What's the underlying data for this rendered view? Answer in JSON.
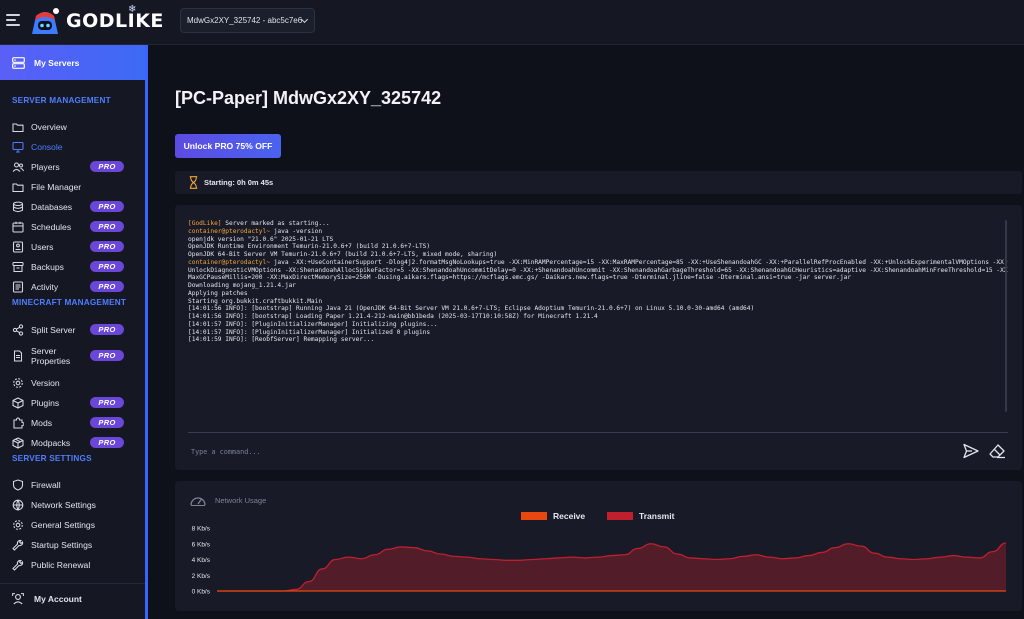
{
  "topbar": {
    "logo_text": "GODLIKE",
    "server_selector": "MdwGx2XY_325742 - abc5c7e6"
  },
  "sidebar": {
    "my_servers": "My Servers",
    "sections": [
      {
        "title": "SERVER MANAGEMENT",
        "items": [
          {
            "label": "Overview",
            "icon": "folder-icon",
            "pro": false
          },
          {
            "label": "Console",
            "icon": "monitor-icon",
            "pro": false,
            "active": true
          },
          {
            "label": "Players",
            "icon": "users-icon",
            "pro": true
          },
          {
            "label": "File Manager",
            "icon": "folder-icon",
            "pro": false
          },
          {
            "label": "Databases",
            "icon": "database-icon",
            "pro": true
          },
          {
            "label": "Schedules",
            "icon": "calendar-icon",
            "pro": true
          },
          {
            "label": "Users",
            "icon": "id-card-icon",
            "pro": true
          },
          {
            "label": "Backups",
            "icon": "archive-icon",
            "pro": true
          },
          {
            "label": "Activity",
            "icon": "list-icon",
            "pro": true
          }
        ]
      },
      {
        "title": "MINECRAFT MANAGEMENT",
        "items": [
          {
            "label": "Split Server",
            "icon": "share-icon",
            "pro": true
          },
          {
            "label": "Server Properties",
            "icon": "file-icon",
            "pro": true
          },
          {
            "label": "Version",
            "icon": "gear-icon",
            "pro": false
          },
          {
            "label": "Plugins",
            "icon": "cube-icon",
            "pro": true
          },
          {
            "label": "Mods",
            "icon": "puzzle-icon",
            "pro": true
          },
          {
            "label": "Modpacks",
            "icon": "package-icon",
            "pro": true
          }
        ]
      },
      {
        "title": "SERVER SETTINGS",
        "items": [
          {
            "label": "Firewall",
            "icon": "shield-icon",
            "pro": false
          },
          {
            "label": "Network Settings",
            "icon": "network-icon",
            "pro": false
          },
          {
            "label": "General Settings",
            "icon": "gear-icon",
            "pro": false
          },
          {
            "label": "Startup Settings",
            "icon": "wrench-icon",
            "pro": false
          },
          {
            "label": "Public Renewal",
            "icon": "wrench-icon",
            "pro": false
          }
        ]
      }
    ],
    "pro_badge": "PRO",
    "account": "My Account"
  },
  "main": {
    "title": "[PC-Paper] MdwGx2XY_325742",
    "unlock_button": "Unlock PRO 75% OFF",
    "status": "Starting: 0h 0m 45s",
    "console_lines": [
      {
        "tag": "[GodLike]",
        "text": " Server marked as starting..."
      },
      {
        "prompt": "container@pterodactyl~",
        "text": " java -version"
      },
      {
        "text": "openjdk version \"21.0.6\" 2025-01-21 LTS"
      },
      {
        "text": "OpenJDK Runtime Environment Temurin-21.0.6+7 (build 21.0.6+7-LTS)"
      },
      {
        "text": "OpenJDK 64-Bit Server VM Temurin-21.0.6+7 (build 21.0.6+7-LTS, mixed mode, sharing)"
      },
      {
        "prompt": "container@pterodactyl~",
        "text": " java -XX:+UseContainerSupport -Dlog4j2.formatMsgNoLookups=true -XX:MinRAMPercentage=15 -XX:MaxRAMPercentage=85 -XX:+UseShenandoahGC -XX:+ParallelRefProcEnabled -XX:+UnlockExperimentalVMOptions -XX:+"
      },
      {
        "text": "UnlockDiagnosticVMOptions -XX:ShenandoahAllocSpikeFactor=5 -XX:ShenandoahUncommitDelay=0 -XX:+ShenandoahUncommit -XX:ShenandoahGarbageThreshold=65 -XX:ShenandoahGCHeuristics=adaptive -XX:ShenandoahMinFreeThreshold=15 -XX:"
      },
      {
        "text": "MaxGCPauseMillis=200 -XX:MaxDirectMemorySize=256M -Dusing.aikars.flags=https://mcflags.emc.gs/ -Daikars.new.flags=true -Dterminal.jline=false -Dterminal.ansi=true -jar server.jar"
      },
      {
        "text": "Downloading mojang_1.21.4.jar"
      },
      {
        "text": "Applying patches"
      },
      {
        "text": "Starting org.bukkit.craftbukkit.Main"
      },
      {
        "text": "[14:01:56 INFO]: [bootstrap] Running Java 21 (OpenJDK 64-Bit Server VM 21.0.6+7-LTS; Eclipse Adoptium Temurin-21.0.6+7) on Linux 5.10.0-30-amd64 (amd64)"
      },
      {
        "text": "[14:01:56 INFO]: [bootstrap] Loading Paper 1.21.4-212-main@bb1beda (2025-03-17T10:10:58Z) for Minecraft 1.21.4"
      },
      {
        "text": "[14:01:57 INFO]: [PluginInitializerManager] Initializing plugins..."
      },
      {
        "text": "[14:01:57 INFO]: [PluginInitializerManager] Initialized 0 plugins"
      },
      {
        "text": "[14:01:59 INFO]: [ReobfServer] Remapping server..."
      }
    ],
    "command_placeholder": "Type a command..."
  },
  "chart_data": {
    "type": "area",
    "title": "Network Usage",
    "series": [
      {
        "name": "Receive",
        "color": "#e8470f",
        "values": [
          0,
          0,
          0,
          0,
          0,
          0,
          0,
          0,
          0,
          0,
          0,
          0,
          0,
          0,
          0,
          0,
          0,
          0,
          0,
          0,
          0,
          0,
          0,
          0,
          0,
          0,
          0,
          0,
          0,
          0,
          0,
          0,
          0,
          0,
          0,
          0,
          0,
          0,
          0,
          0,
          0,
          0,
          0,
          0,
          0,
          0,
          0,
          0,
          0,
          0,
          0,
          0,
          0,
          0,
          0,
          0,
          0,
          0,
          0,
          0,
          0
        ]
      },
      {
        "name": "Transmit",
        "color": "#c0202e",
        "values": [
          0,
          0,
          0,
          0,
          0,
          0,
          0.2,
          1.2,
          2.8,
          4.0,
          4.3,
          4.1,
          4.6,
          5.3,
          5.6,
          5.5,
          5.1,
          4.7,
          4.4,
          4.3,
          4.1,
          4.0,
          3.9,
          3.9,
          4.0,
          4.1,
          4.2,
          4.3,
          4.2,
          4.3,
          4.5,
          4.6,
          5.4,
          6.0,
          5.6,
          4.7,
          4.2,
          4.1,
          4.0,
          4.1,
          4.4,
          4.6,
          4.3,
          4.1,
          4.2,
          4.5,
          4.9,
          5.5,
          6.0,
          5.7,
          4.8,
          4.3,
          4.1,
          4.0,
          4.1,
          4.3,
          4.5,
          4.3,
          4.2,
          5.0,
          6.1
        ]
      }
    ],
    "yticks": [
      "0 Kb/s",
      "2 Kb/s",
      "4 Kb/s",
      "6 Kb/s",
      "8 Kb/s"
    ],
    "ylim": [
      0,
      8
    ],
    "grid": false,
    "legend": "top-center"
  }
}
